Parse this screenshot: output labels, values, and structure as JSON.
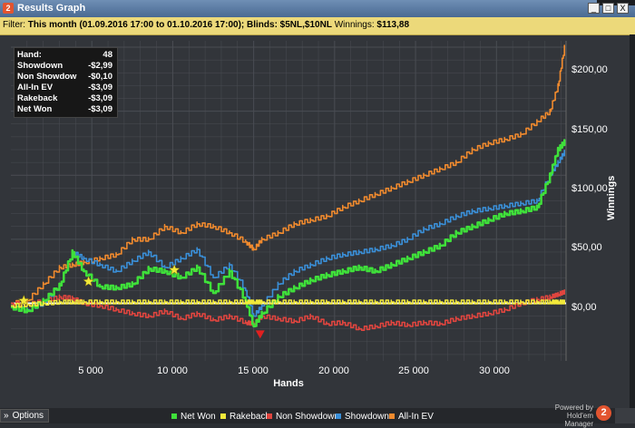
{
  "window": {
    "title": "Results Graph",
    "app_icon": "2",
    "buttons": {
      "minimize": "_",
      "maximize": "□",
      "close": "X"
    }
  },
  "filter": {
    "prefix": "Filter:",
    "text": "This month (01.09.2016 17:00 to 01.10.2016 17:00); Blinds: $5NL,$10NL",
    "winnings_label": "Winnings:",
    "winnings_value": "$113,88"
  },
  "stats": [
    {
      "label": "Hand:",
      "value": "48"
    },
    {
      "label": "Showdown",
      "value": "-$2,99"
    },
    {
      "label": "Non Showdow",
      "value": "-$0,10"
    },
    {
      "label": "All-In EV",
      "value": "-$3,09"
    },
    {
      "label": "Rakeback",
      "value": "-$3,09"
    },
    {
      "label": "Net Won",
      "value": "-$3,09"
    }
  ],
  "bottom": {
    "options_label": "Options",
    "powered_line1": "Powered by",
    "powered_line2": "Hold'em Manager",
    "logo": "2"
  },
  "colors": {
    "net_won": "#3fe03a",
    "rakeback": "#f2e93a",
    "non_showdown": "#e0453f",
    "showdown": "#3a8fd8",
    "all_in_ev": "#f08a2e",
    "zero_line": "#ffffff",
    "grid": "#4a4d53"
  },
  "chart_data": {
    "type": "line",
    "xlabel": "Hands",
    "ylabel": "Winnings",
    "xlim": [
      0,
      34300
    ],
    "ylim": [
      -45,
      205
    ],
    "x_ticks": [
      5000,
      10000,
      15000,
      20000,
      25000,
      30000
    ],
    "x_tick_labels": [
      "5 000",
      "10 000",
      "15 000",
      "20 000",
      "25 000",
      "30 000"
    ],
    "y_ticks": [
      0,
      50,
      100,
      150,
      200
    ],
    "y_tick_labels": [
      "$0,00",
      "$50,00",
      "$100,00",
      "$150,00",
      "$200,00"
    ],
    "grid": true,
    "legend_position": "bottom",
    "x": [
      0,
      1000,
      2000,
      3000,
      3800,
      4500,
      5500,
      6500,
      7500,
      8500,
      9500,
      10500,
      11500,
      12500,
      13500,
      14500,
      15000,
      15500,
      16500,
      17500,
      18500,
      19500,
      20500,
      21500,
      22500,
      23500,
      24500,
      25500,
      26500,
      27500,
      28500,
      29500,
      30500,
      31500,
      32500,
      33300,
      33800,
      34200
    ],
    "series": [
      {
        "name": "Net Won",
        "values": [
          -3,
          -6,
          2,
          14,
          40,
          25,
          13,
          12,
          15,
          27,
          25,
          20,
          28,
          8,
          25,
          2,
          -18,
          -8,
          5,
          12,
          18,
          22,
          25,
          28,
          25,
          30,
          35,
          40,
          45,
          55,
          60,
          65,
          70,
          72,
          75,
          100,
          120,
          126
        ]
      },
      {
        "name": "Rakeback",
        "values": [
          -2,
          -1,
          0,
          1,
          1,
          1,
          1,
          1,
          1,
          1,
          1,
          1,
          1,
          1,
          1,
          1,
          1,
          1,
          1,
          1,
          1,
          1,
          1,
          1,
          1,
          1,
          1,
          1,
          1,
          1,
          1,
          1,
          1,
          1,
          1,
          1,
          1,
          1
        ]
      },
      {
        "name": "Non Showdown",
        "values": [
          0,
          -1,
          2,
          5,
          4,
          0,
          -2,
          -5,
          -8,
          -10,
          -6,
          -12,
          -8,
          -13,
          -10,
          -15,
          -16,
          -10,
          -12,
          -14,
          -10,
          -16,
          -15,
          -20,
          -18,
          -15,
          -17,
          -15,
          -16,
          -12,
          -10,
          -8,
          -5,
          0,
          3,
          5,
          7,
          9
        ]
      },
      {
        "name": "Showdown",
        "values": [
          -3,
          -5,
          0,
          14,
          40,
          35,
          30,
          25,
          33,
          40,
          28,
          35,
          42,
          20,
          30,
          10,
          -10,
          -2,
          15,
          25,
          30,
          35,
          38,
          40,
          42,
          45,
          50,
          58,
          62,
          68,
          72,
          74,
          76,
          78,
          80,
          100,
          110,
          118
        ]
      },
      {
        "name": "All-In EV",
        "values": [
          0,
          2,
          15,
          28,
          30,
          32,
          35,
          38,
          50,
          50,
          60,
          55,
          62,
          60,
          55,
          48,
          42,
          50,
          55,
          62,
          65,
          68,
          75,
          80,
          85,
          90,
          95,
          100,
          105,
          110,
          120,
          125,
          128,
          132,
          142,
          150,
          170,
          200
        ]
      }
    ],
    "markers": [
      {
        "type": "star",
        "x": 800,
        "y": 2
      },
      {
        "type": "star",
        "x": 4800,
        "y": 17
      },
      {
        "type": "star",
        "x": 10100,
        "y": 26
      },
      {
        "type": "triangle-down",
        "x": 15400,
        "y": -24
      }
    ]
  }
}
